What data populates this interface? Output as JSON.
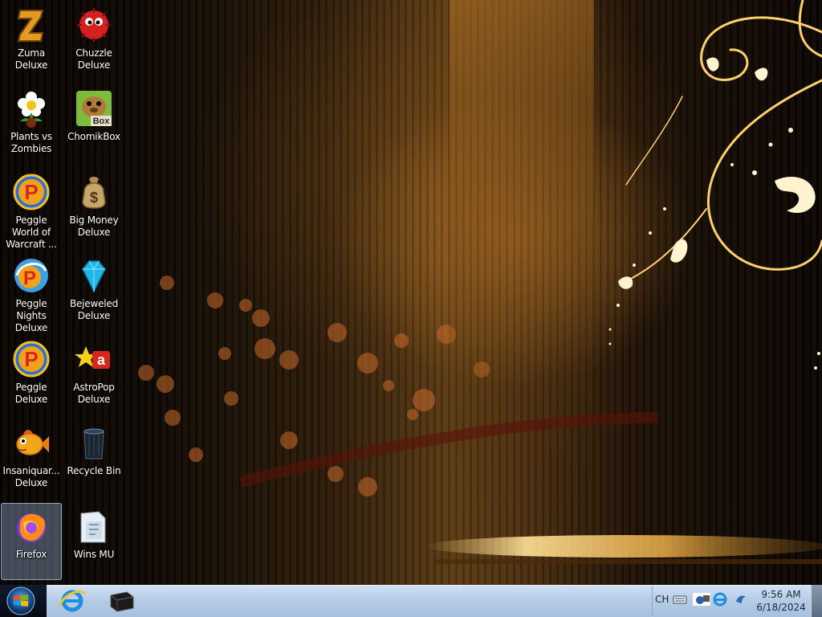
{
  "desktop": {
    "icons": [
      {
        "id": "zuma",
        "label": "Zuma Deluxe",
        "icon": "zuma-icon"
      },
      {
        "id": "chuzzle",
        "label": "Chuzzle Deluxe",
        "icon": "chuzzle-icon"
      },
      {
        "id": "pvz",
        "label": "Plants vs Zombies",
        "icon": "plants-vs-zombies-icon"
      },
      {
        "id": "chomikbox",
        "label": "ChomikBox",
        "icon": "chomikbox-icon",
        "badge": "Box"
      },
      {
        "id": "peggle-wow",
        "label": "Peggle World of Warcraft ...",
        "icon": "peggle-icon",
        "glyph": "P"
      },
      {
        "id": "big-money",
        "label": "Big Money Deluxe",
        "icon": "money-bag-icon",
        "glyph": "$"
      },
      {
        "id": "peggle-nights",
        "label": "Peggle Nights Deluxe",
        "icon": "peggle-nights-icon",
        "glyph": "P"
      },
      {
        "id": "bejeweled",
        "label": "Bejeweled Deluxe",
        "icon": "gem-icon"
      },
      {
        "id": "peggle",
        "label": "Peggle Deluxe",
        "icon": "peggle-icon",
        "glyph": "P"
      },
      {
        "id": "astropop",
        "label": "AstroPop Deluxe",
        "icon": "astropop-icon",
        "glyph": "a"
      },
      {
        "id": "insaniquarium",
        "label": "Insaniquar... Deluxe",
        "icon": "fish-icon"
      },
      {
        "id": "recycle-bin",
        "label": "Recycle Bin",
        "icon": "recycle-bin-icon"
      },
      {
        "id": "firefox",
        "label": "Firefox",
        "icon": "firefox-icon",
        "selected": true
      },
      {
        "id": "wins-mu",
        "label": "Wins MU",
        "icon": "folder-icon"
      }
    ]
  },
  "taskbar": {
    "start_icon": "windows-logo-icon",
    "pinned": [
      {
        "label": "Internet Explorer",
        "icon": "internet-explorer-icon"
      },
      {
        "label": "Console",
        "icon": "terminal-icon"
      }
    ],
    "tray": {
      "language": "CH",
      "icons": [
        "keyboard-icon",
        "network-icon",
        "shield-icon",
        "bird-icon"
      ]
    },
    "clock": {
      "time": "9:56 AM",
      "date": "6/18/2024"
    }
  }
}
